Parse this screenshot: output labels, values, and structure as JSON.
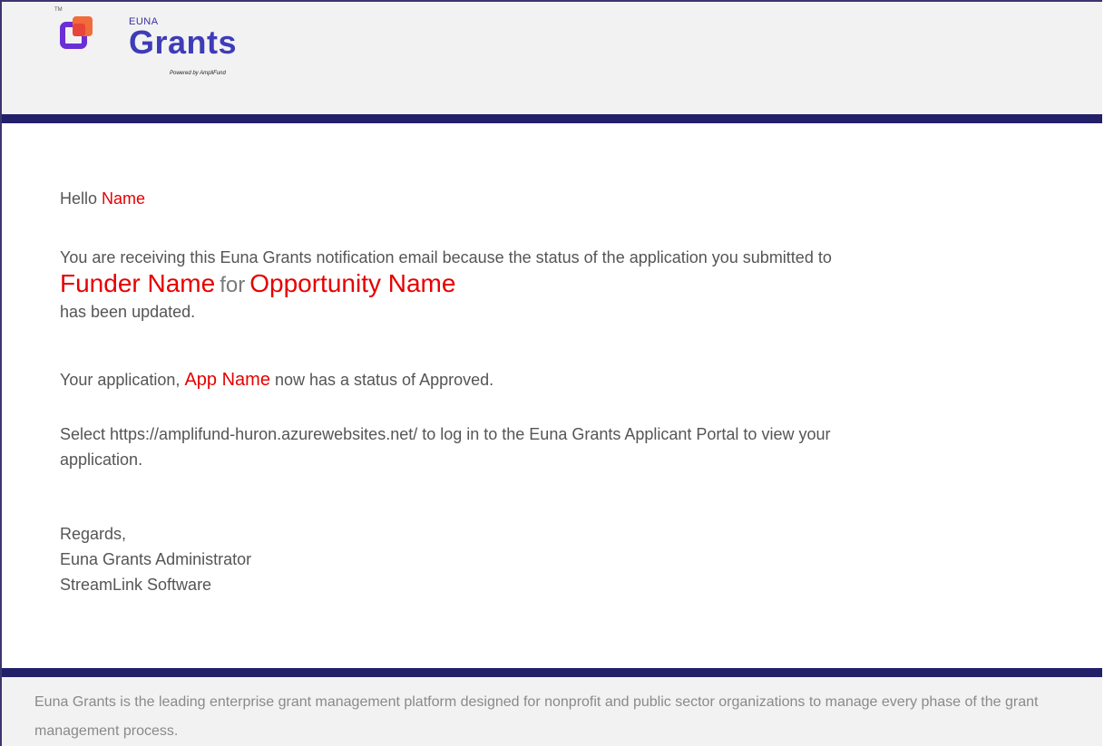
{
  "header": {
    "tm": "TM",
    "brand_small": "EUNA",
    "brand_big": "Grants",
    "powered_by": "Powered by AmpliFund"
  },
  "email": {
    "greeting": "Hello",
    "recipient_name": "Name",
    "p2_part1": "You are receiving this Euna Grants notification email because the status of the application you submitted to",
    "funder_name": "Funder Name",
    "for_word": "for",
    "opportunity_name": "Opportunity Name",
    "p2_part2": "has been updated.",
    "p3_part1": "Your application,",
    "app_name": "App Name",
    "p3_part2": "now has a status of Approved.",
    "p4_text": "Select https://amplifund-huron.azurewebsites.net/ to log in to the Euna Grants Applicant Portal to view your application.",
    "regards": "Regards,",
    "signature_title": "Euna Grants Administrator",
    "signature_company": "StreamLink Software"
  },
  "footer": {
    "text": "Euna Grants is the leading enterprise grant management platform designed for nonprofit and public sector organizations to manage every phase of the grant management process."
  },
  "colors": {
    "brand_navy": "#23206a",
    "highlight_red": "#e60000",
    "brand_purple": "#6a2fd6",
    "brand_orange": "#f26b3a"
  }
}
